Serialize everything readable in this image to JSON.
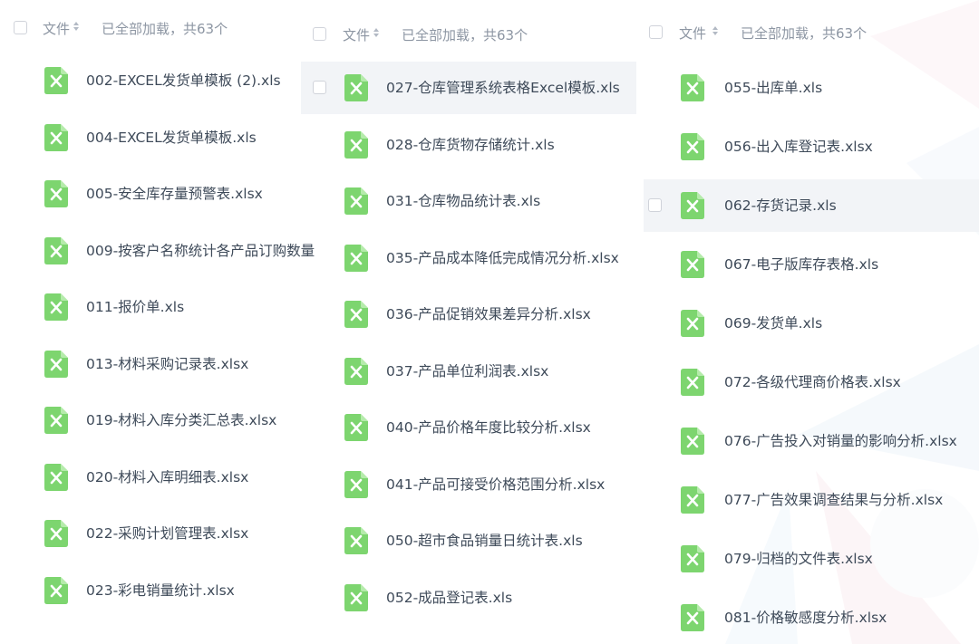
{
  "colors": {
    "file_icon": "#7dd56f",
    "text": "#3e4a59",
    "muted": "#8d96a3",
    "row_highlight": "#f2f4f7"
  },
  "panels": [
    {
      "header": {
        "name_label": "文件",
        "status": "已全部加载，共63个"
      },
      "files": [
        {
          "name": "002-EXCEL发货单模板 (2).xls"
        },
        {
          "name": "004-EXCEL发货单模板.xls"
        },
        {
          "name": "005-安全库存量预警表.xlsx"
        },
        {
          "name": "009-按客户名称统计各产品订购数量"
        },
        {
          "name": "011-报价单.xls"
        },
        {
          "name": "013-材料采购记录表.xlsx"
        },
        {
          "name": "019-材料入库分类汇总表.xlsx"
        },
        {
          "name": "020-材料入库明细表.xlsx"
        },
        {
          "name": "022-采购计划管理表.xlsx"
        },
        {
          "name": "023-彩电销量统计.xlsx"
        }
      ]
    },
    {
      "header": {
        "name_label": "文件",
        "status": "已全部加载，共63个"
      },
      "files": [
        {
          "name": "027-仓库管理系统表格Excel模板.xls"
        },
        {
          "name": "028-仓库货物存储统计.xls"
        },
        {
          "name": "031-仓库物品统计表.xls"
        },
        {
          "name": "035-产品成本降低完成情况分析.xlsx"
        },
        {
          "name": "036-产品促销效果差异分析.xlsx"
        },
        {
          "name": "037-产品单位利润表.xlsx"
        },
        {
          "name": "040-产品价格年度比较分析.xlsx"
        },
        {
          "name": "041-产品可接受价格范围分析.xlsx"
        },
        {
          "name": "050-超市食品销量日统计表.xls"
        },
        {
          "name": "052-成品登记表.xls"
        }
      ]
    },
    {
      "header": {
        "name_label": "文件",
        "status": "已全部加载，共63个"
      },
      "files": [
        {
          "name": "055-出库单.xls"
        },
        {
          "name": "056-出入库登记表.xlsx"
        },
        {
          "name": "062-存货记录.xls"
        },
        {
          "name": "067-电子版库存表格.xls"
        },
        {
          "name": "069-发货单.xls"
        },
        {
          "name": "072-各级代理商价格表.xlsx"
        },
        {
          "name": "076-广告投入对销量的影响分析.xlsx"
        },
        {
          "name": "077-广告效果调查结果与分析.xlsx"
        },
        {
          "name": "079-归档的文件表.xlsx"
        },
        {
          "name": "081-价格敏感度分析.xlsx"
        }
      ]
    }
  ]
}
